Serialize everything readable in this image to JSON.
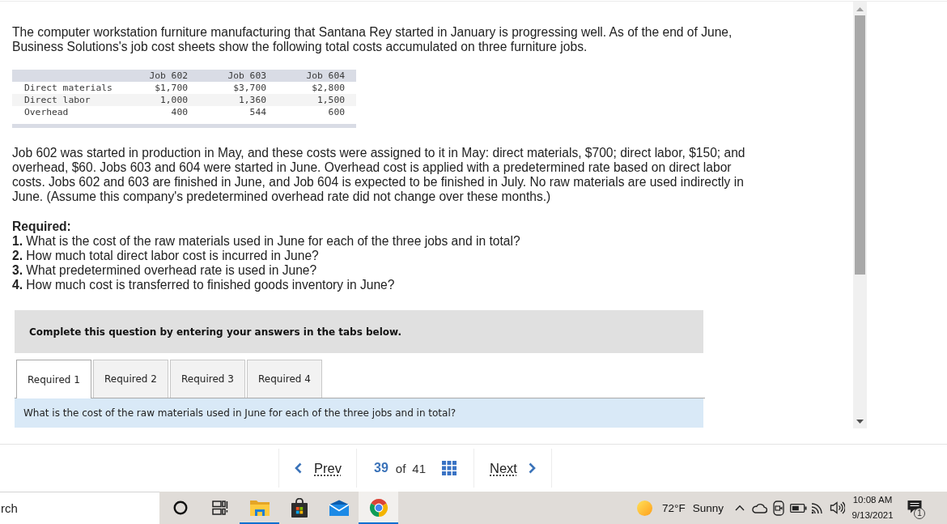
{
  "problem": {
    "intro": "The computer workstation furniture manufacturing that Santana Rey started in January is progressing well. As of the end of June, Business Solutions's job cost sheets show the following total costs accumulated on three furniture jobs.",
    "cost_table": {
      "columns": [
        "Job 602",
        "Job 603",
        "Job 604"
      ],
      "rows": [
        {
          "label": "Direct materials",
          "values": [
            "$1,700",
            "$3,700",
            "$2,800"
          ]
        },
        {
          "label": "Direct labor",
          "values": [
            "1,000",
            "1,360",
            "1,500"
          ]
        },
        {
          "label": "Overhead",
          "values": [
            "400",
            "544",
            "600"
          ]
        }
      ]
    },
    "details": "Job 602 was started in production in May, and these costs were assigned to it in May: direct materials, $700; direct labor, $150; and overhead, $60. Jobs 603 and 604 were started in June. Overhead cost is applied with a predetermined rate based on direct labor costs. Jobs 602 and 603 are finished in June, and Job 604 is expected to be finished in July. No raw materials are used indirectly in June. (Assume this company's predetermined overhead rate did not change over these months.)",
    "required_heading": "Required:",
    "questions": [
      "**1.** What is the cost of the raw materials used in June for each of the three jobs and in total?",
      "**2.** How much total direct labor cost is incurred in June?",
      "**3.** What predetermined overhead rate is used in June?",
      "**4.** How much cost is transferred to finished goods inventory in June?"
    ]
  },
  "instructions": "Complete this question by entering your answers in the tabs below.",
  "tabs": [
    {
      "label": "Required 1",
      "selected": true
    },
    {
      "label": "Required 2",
      "selected": false
    },
    {
      "label": "Required 3",
      "selected": false
    },
    {
      "label": "Required 4",
      "selected": false
    }
  ],
  "tab_prompt": "What is the cost of the raw materials used in June for each of the three jobs and in total?",
  "pagination": {
    "prev": "Prev",
    "current": "39",
    "of": "of",
    "total": "41",
    "next": "Next"
  },
  "taskbar": {
    "search": {
      "placeholder": "rch"
    },
    "apps": [
      {
        "kind": "circle",
        "running": false,
        "selected": false
      },
      {
        "kind": "task_view",
        "running": false,
        "selected": false
      },
      {
        "kind": "folder",
        "running": true,
        "selected": false
      },
      {
        "kind": "store",
        "running": false,
        "selected": false
      },
      {
        "kind": "mail",
        "running": false,
        "selected": false
      },
      {
        "kind": "browser",
        "running": true,
        "selected": true
      }
    ],
    "weather": {
      "temperature": "72°F",
      "condition": "Sunny"
    },
    "clock": {
      "time": "10:08 AM",
      "date": "9/13/2021"
    },
    "notification_count": "1"
  }
}
